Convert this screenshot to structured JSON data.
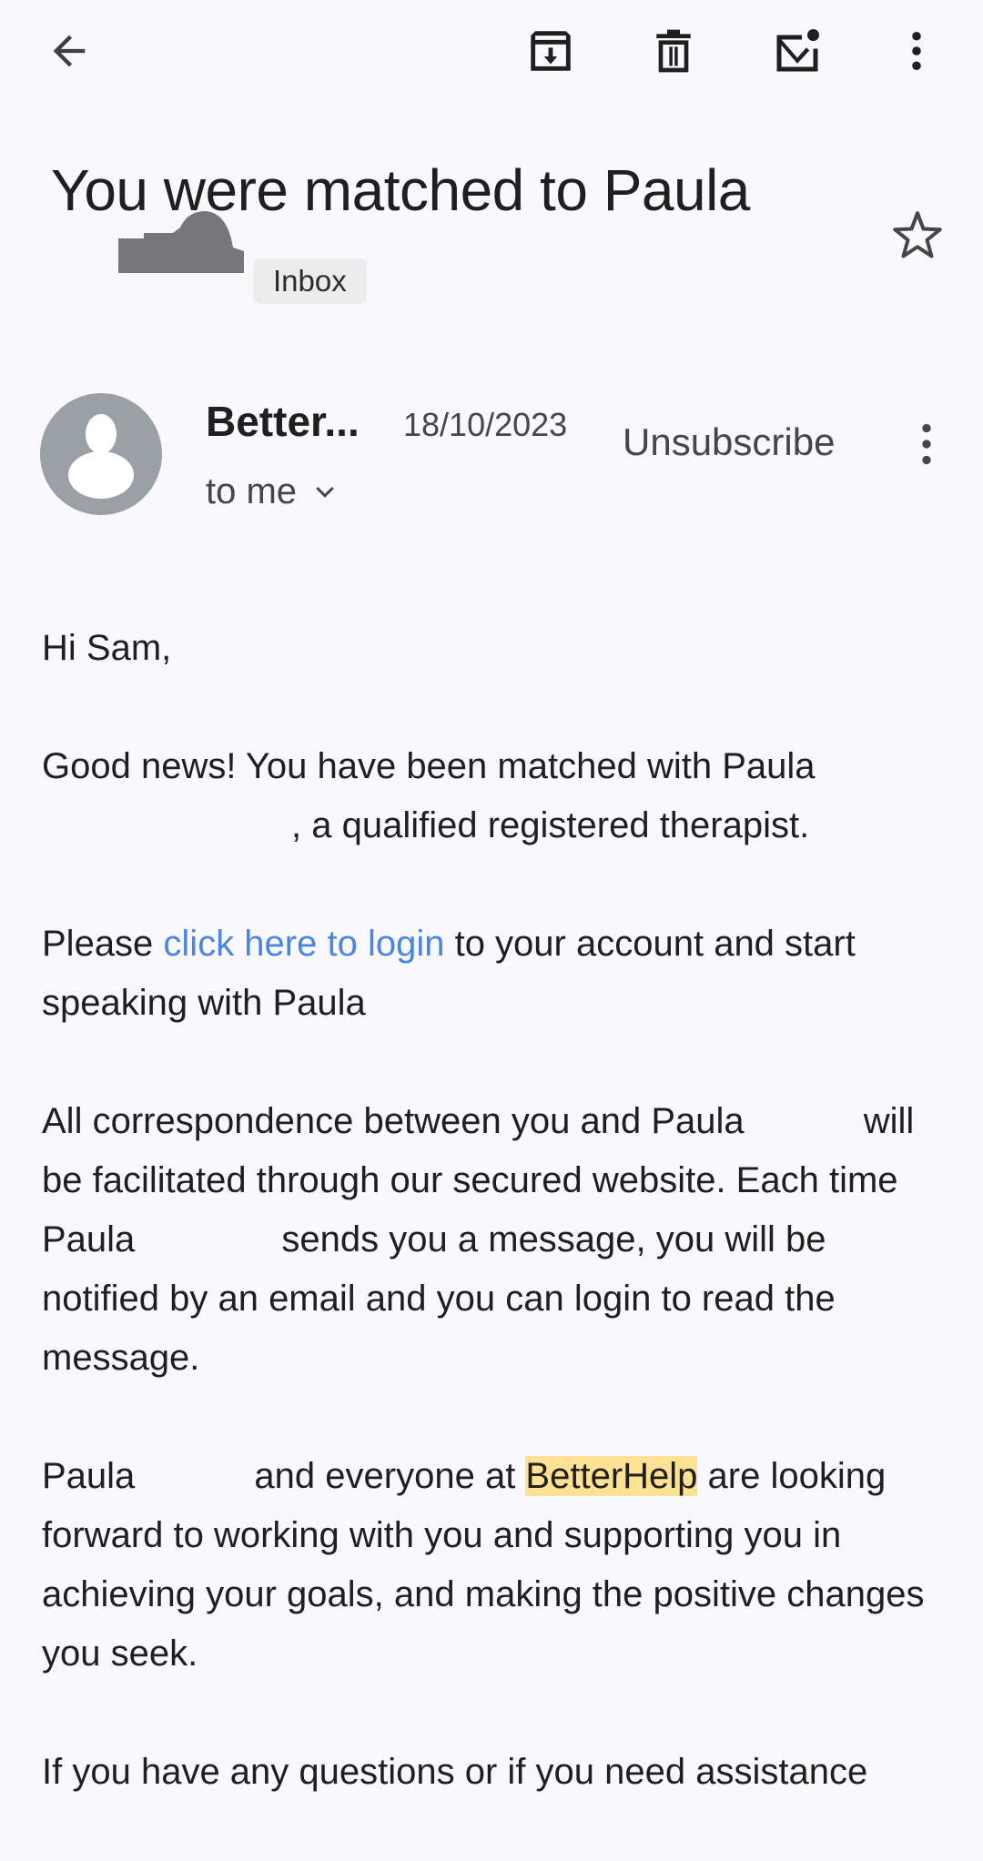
{
  "toolbar": {
    "back_icon": "arrow-left-icon",
    "archive_icon": "archive-icon",
    "delete_icon": "trash-icon",
    "mark_unread_icon": "mark-unread-icon",
    "more_icon": "more-vert-icon"
  },
  "email": {
    "subject": "You were matched to Paula",
    "label_chip": "Inbox",
    "starred": false,
    "sender_display": "Better...",
    "date": "18/10/2023",
    "recipient": "to me",
    "unsubscribe_label": "Unsubscribe",
    "body": {
      "greeting": "Hi Sam,",
      "p1_text": "Good news! You have been matched with Paula",
      "p1_tail": ", a qualified registered therapist.",
      "p2_pre": "Please ",
      "p2_link": "click here to login",
      "p2_post": " to your account and start speaking with Paula",
      "p3_a": "All correspondence between you and Paula",
      "p3_b": " will be facilitated through our secured website. Each time Paula",
      "p3_c": " sends you a message, you will be notified by an email and you can login to read the message.",
      "p4_a": "Paula",
      "p4_b": " and everyone at ",
      "p4_highlight": "BetterHelp",
      "p4_c": " are looking forward to working with you and supporting you in achieving your goals, and making the positive changes you seek.",
      "p5": "If you have any questions or if you need assistance"
    }
  },
  "colors": {
    "background": "#f8f8fd",
    "link": "#4a86e0",
    "highlight": "#fde293",
    "avatar": "#9aa0a6"
  }
}
